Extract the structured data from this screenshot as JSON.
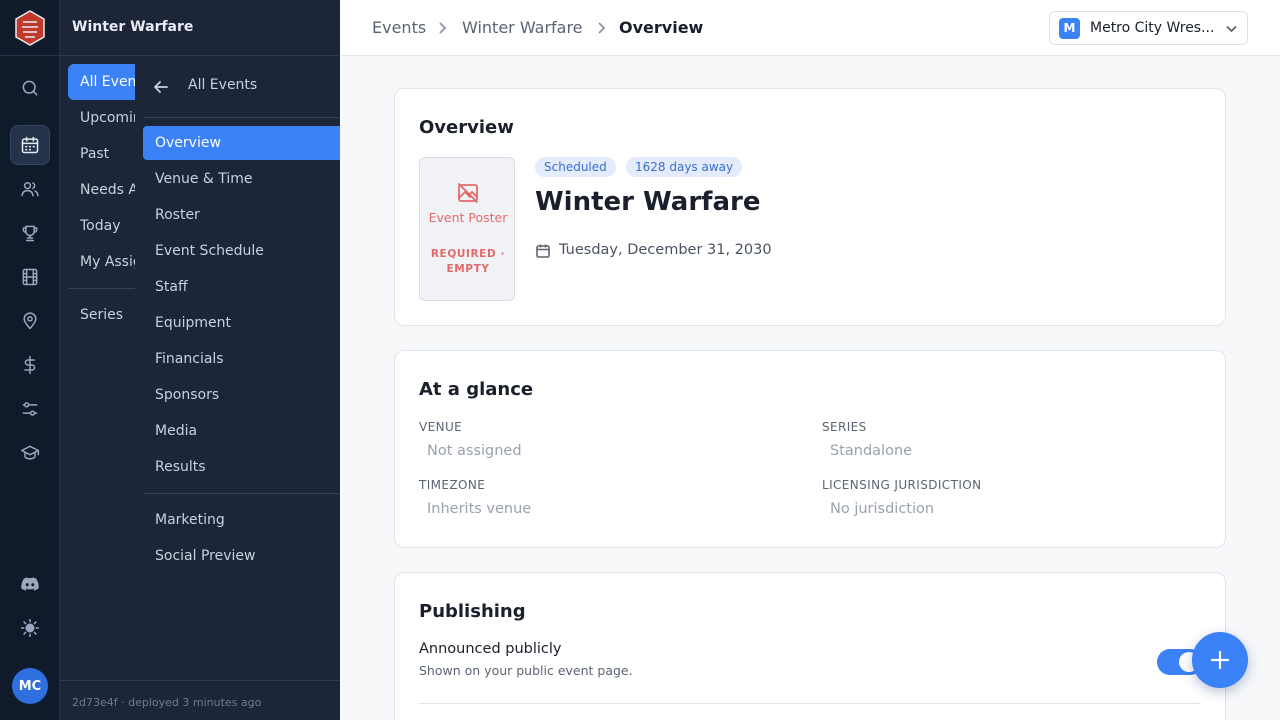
{
  "rail": {
    "icons": [
      "search-icon",
      "calendar-icon",
      "users-icon",
      "trophy-icon",
      "film-icon",
      "map-pin-icon",
      "dollar-icon",
      "sliders-icon",
      "graduation-cap-icon",
      "discord-icon",
      "sun-icon"
    ],
    "active": "calendar-icon",
    "avatar_initials": "MC"
  },
  "nav": {
    "title": "Winter Warfare",
    "level1": [
      "All Events",
      "Upcoming",
      "Past",
      "Needs Attention",
      "Today",
      "My Assignments",
      "Series"
    ],
    "level1_active": "All Events",
    "back_label": "All Events",
    "level2": [
      "Overview",
      "Venue & Time",
      "Roster",
      "Event Schedule",
      "Staff",
      "Equipment",
      "Financials",
      "Sponsors",
      "Media",
      "Results"
    ],
    "level2_extra": [
      "Marketing",
      "Social Preview"
    ],
    "level2_active": "Overview",
    "deploy_text": "2d73e4f · deployed 3 minutes ago"
  },
  "topbar": {
    "breadcrumb": [
      "Events",
      "Winter Warfare",
      "Overview"
    ],
    "org_initial": "M",
    "org_name": "Metro City Wres..."
  },
  "overview": {
    "title": "Overview",
    "poster_label": "Event Poster",
    "poster_status": "REQUIRED · EMPTY",
    "status_pill": "Scheduled",
    "countdown_pill": "1628 days away",
    "event_name": "Winter Warfare",
    "event_date": "Tuesday, December 31, 2030"
  },
  "glance": {
    "title": "At a glance",
    "venue_label": "VENUE",
    "venue_value": "Not assigned",
    "series_label": "SERIES",
    "series_value": "Standalone",
    "timezone_label": "TIMEZONE",
    "timezone_value": "Inherits venue",
    "licensing_label": "LICENSING JURISDICTION",
    "licensing_value": "No jurisdiction"
  },
  "publishing": {
    "title": "Publishing",
    "announced_label": "Announced publicly",
    "announced_desc": "Shown on your public event page.",
    "announced_on": true
  },
  "colors": {
    "accent": "#3b82f6",
    "rail_bg": "#0f1a2b",
    "nav_bg": "#1c2638",
    "required": "#e36a6a"
  }
}
